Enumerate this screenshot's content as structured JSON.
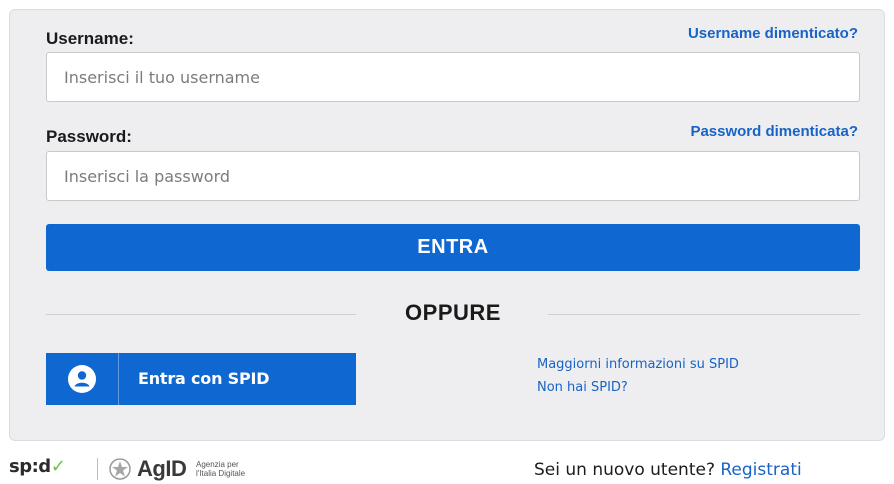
{
  "login": {
    "username_label": "Username:",
    "username_forgot": "Username dimenticato?",
    "username_placeholder": "Inserisci il tuo username",
    "username_value": "",
    "password_label": "Password:",
    "password_forgot": "Password dimenticata?",
    "password_placeholder": "Inserisci la password",
    "password_value": "",
    "submit_label": "ENTRA",
    "separator": "OPPURE"
  },
  "spid": {
    "button_label": "Entra con SPID",
    "more_info": "Maggiorni informazioni su SPID",
    "no_spid": "Non hai SPID?"
  },
  "footer": {
    "spid_logo_text": "sp:d",
    "agid_text": "AgID",
    "agid_sub_line1": "Agenzia per",
    "agid_sub_line2": "l'Italia Digitale",
    "new_user_text": "Sei un nuovo utente?",
    "register_link": "Registrati"
  },
  "colors": {
    "primary": "#0f67d2",
    "link": "#1763c6",
    "card_bg": "#eeeef0",
    "spid_check": "#68c24f"
  },
  "icons": {
    "spid_button_icon": "user-circle-icon",
    "spid_logo_mark": "check-icon",
    "agid_emblem": "italian-emblem-icon"
  }
}
